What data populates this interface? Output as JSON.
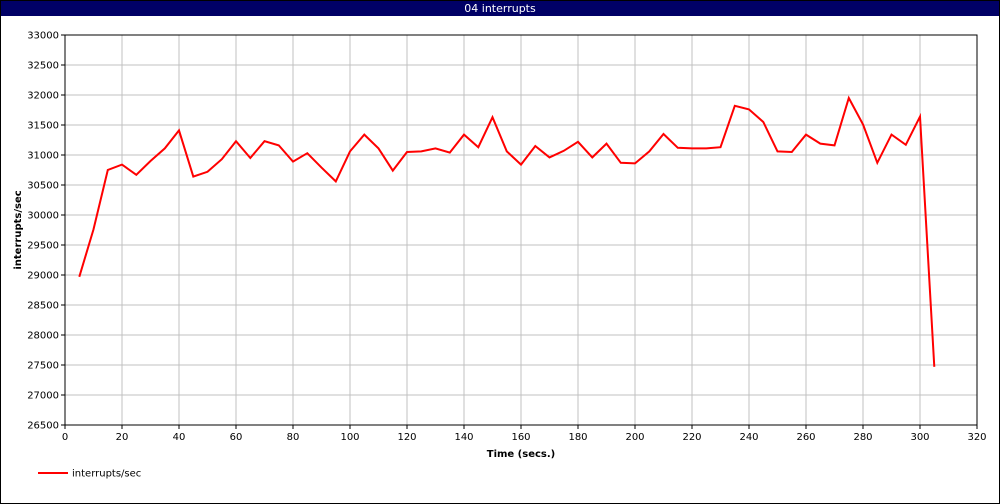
{
  "window": {
    "title": "04 interrupts"
  },
  "colors": {
    "titlebar": "#000066",
    "series": "#ff0000",
    "grid": "#c0c0c0"
  },
  "chart_data": {
    "type": "line",
    "xlabel": "Time (secs.)",
    "ylabel": "interrupts/sec",
    "xlim": [
      0,
      320
    ],
    "ylim": [
      26500,
      33000
    ],
    "xticks": [
      0,
      20,
      40,
      60,
      80,
      100,
      120,
      140,
      160,
      180,
      200,
      220,
      240,
      260,
      280,
      300,
      320
    ],
    "yticks": [
      26500,
      27000,
      27500,
      28000,
      28500,
      29000,
      29500,
      30000,
      30500,
      31000,
      31500,
      32000,
      32500,
      33000
    ],
    "grid": true,
    "legend_position": "bottom-left",
    "series": [
      {
        "name": "interrupts/sec",
        "color": "#ff0000",
        "x": [
          5,
          10,
          15,
          20,
          25,
          30,
          35,
          40,
          45,
          50,
          55,
          60,
          65,
          70,
          75,
          80,
          85,
          90,
          95,
          100,
          105,
          110,
          115,
          120,
          125,
          130,
          135,
          140,
          145,
          150,
          155,
          160,
          165,
          170,
          175,
          180,
          185,
          190,
          195,
          200,
          205,
          210,
          215,
          220,
          225,
          230,
          235,
          240,
          245,
          250,
          255,
          260,
          265,
          270,
          275,
          280,
          285,
          290,
          295,
          300,
          305
        ],
        "y": [
          28970,
          29760,
          30750,
          30840,
          30670,
          30900,
          31110,
          31410,
          30640,
          30720,
          30930,
          31230,
          30950,
          31230,
          31160,
          30890,
          31030,
          30790,
          30560,
          31060,
          31340,
          31110,
          30740,
          31050,
          31060,
          31110,
          31040,
          31340,
          31130,
          31630,
          31060,
          30840,
          31150,
          30960,
          31070,
          31220,
          30960,
          31190,
          30870,
          30860,
          31060,
          31350,
          31120,
          31110,
          31110,
          31130,
          31820,
          31760,
          31550,
          31060,
          31050,
          31340,
          31190,
          31160,
          31950,
          31510,
          30870,
          31340,
          31170,
          31640,
          27470
        ]
      }
    ]
  }
}
